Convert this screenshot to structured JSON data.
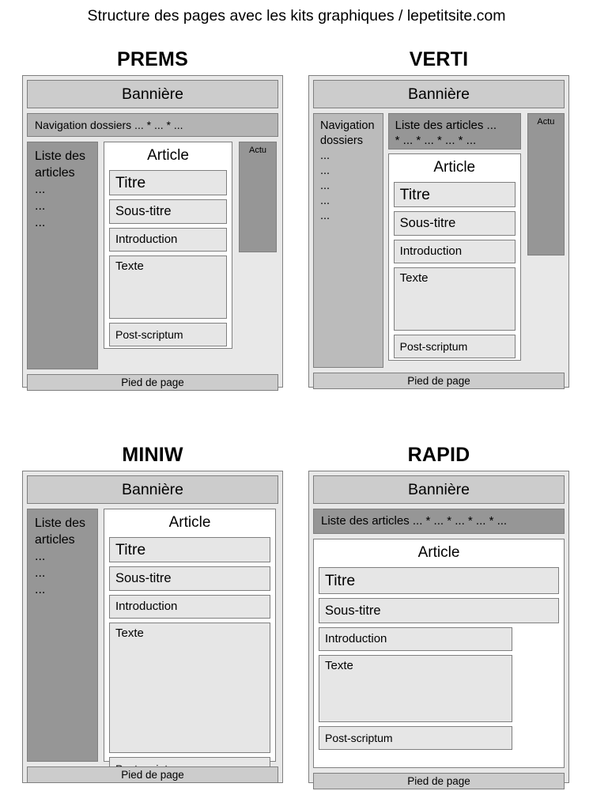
{
  "page": {
    "title": "Structure des pages avec les kits graphiques / lepetitsite.com"
  },
  "common": {
    "banner": "Bannière",
    "footer": "Pied de page",
    "article_heading": "Article",
    "titre": "Titre",
    "sous_titre": "Sous-titre",
    "introduction": "Introduction",
    "texte": "Texte",
    "post_scriptum": "Post-scriptum",
    "actu": "Actu"
  },
  "kits": [
    {
      "id": "prems",
      "name": "PREMS",
      "banner": "Bannière",
      "navigation": "Navigation dossiers ... * ... * ...",
      "sidebar_label": "Liste des\narticles",
      "sidebar_title_line1": "Liste des",
      "sidebar_title_line2": "articles",
      "sidebar_dots": [
        "...",
        "...",
        "..."
      ],
      "article_heading": "Article",
      "fields": [
        "Titre",
        "Sous-titre",
        "Introduction",
        "Texte",
        "Post-scriptum"
      ],
      "actu": "Actu",
      "footer": "Pied de page"
    },
    {
      "id": "verti",
      "name": "VERTI",
      "banner": "Bannière",
      "sidebar_title_line1": "Navigation",
      "sidebar_title_line2": "dossiers",
      "sidebar_dots": [
        "...",
        "...",
        "...",
        "...",
        "..."
      ],
      "liste_line1": "Liste des articles ...",
      "liste_line2": "*  ...  *  ...  *  ...  *  ...",
      "article_heading": "Article",
      "fields": [
        "Titre",
        "Sous-titre",
        "Introduction",
        "Texte",
        "Post-scriptum"
      ],
      "actu": "Actu",
      "footer": "Pied de page"
    },
    {
      "id": "miniw",
      "name": "MINIW",
      "banner": "Bannière",
      "sidebar_title_line1": "Liste des",
      "sidebar_title_line2": "articles",
      "sidebar_dots": [
        "...",
        "...",
        "..."
      ],
      "article_heading": "Article",
      "fields": [
        "Titre",
        "Sous-titre",
        "Introduction",
        "Texte",
        "Post-scriptum"
      ],
      "footer": "Pied de page"
    },
    {
      "id": "rapid",
      "name": "RAPID",
      "banner": "Bannière",
      "liste": "Liste des articles ... * ... * ... * ... * ...",
      "article_heading": "Article",
      "fields": [
        "Titre",
        "Sous-titre",
        "Introduction",
        "Texte",
        "Post-scriptum"
      ],
      "footer": "Pied de page"
    }
  ],
  "colors": {
    "page_background": "#ffffff",
    "frame_background": "#e8e8e8",
    "banner": "#cccccc",
    "navbar": "#b4b4b4",
    "sidebar_dark": "#969696",
    "sidebar_mid": "#bbbbbb",
    "field": "#e6e6e6",
    "article_background": "#ffffff",
    "border": "#7f7f7f",
    "text": "#000000"
  }
}
